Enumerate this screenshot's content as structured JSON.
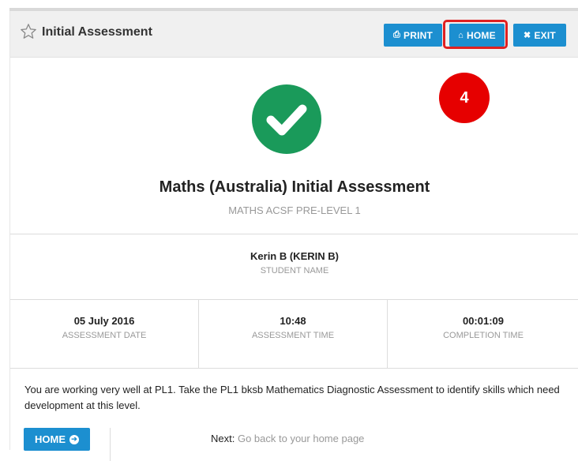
{
  "header": {
    "title": "Initial Assessment",
    "buttons": {
      "print": {
        "icon": "⎙",
        "label": "PRINT"
      },
      "home": {
        "icon": "⌂",
        "label": "HOME"
      },
      "exit": {
        "icon": "✖",
        "label": "EXIT"
      }
    }
  },
  "step_badge": "4",
  "colors": {
    "accent": "#1c8fd0",
    "success": "#1a9a5a",
    "highlight": "#e02020",
    "badge": "#e60000"
  },
  "assessment": {
    "title": "Maths (Australia) Initial Assessment",
    "subtitle": "MATHS ACSF PRE-LEVEL 1"
  },
  "student": {
    "name": "Kerin B (KERIN B)",
    "label": "STUDENT NAME"
  },
  "stats": [
    {
      "value": "05 July 2016",
      "label": "ASSESSMENT DATE"
    },
    {
      "value": "10:48",
      "label": "ASSESSMENT TIME"
    },
    {
      "value": "00:01:09",
      "label": "COMPLETION TIME"
    }
  ],
  "message": "You are working very well at PL1. Take the PL1 bksb Mathematics Diagnostic Assessment to identify skills which need development at this level.",
  "footer": {
    "home_label": "HOME",
    "home_icon": "➔",
    "next_label": "Next:",
    "next_text": "Go back to your home page"
  }
}
